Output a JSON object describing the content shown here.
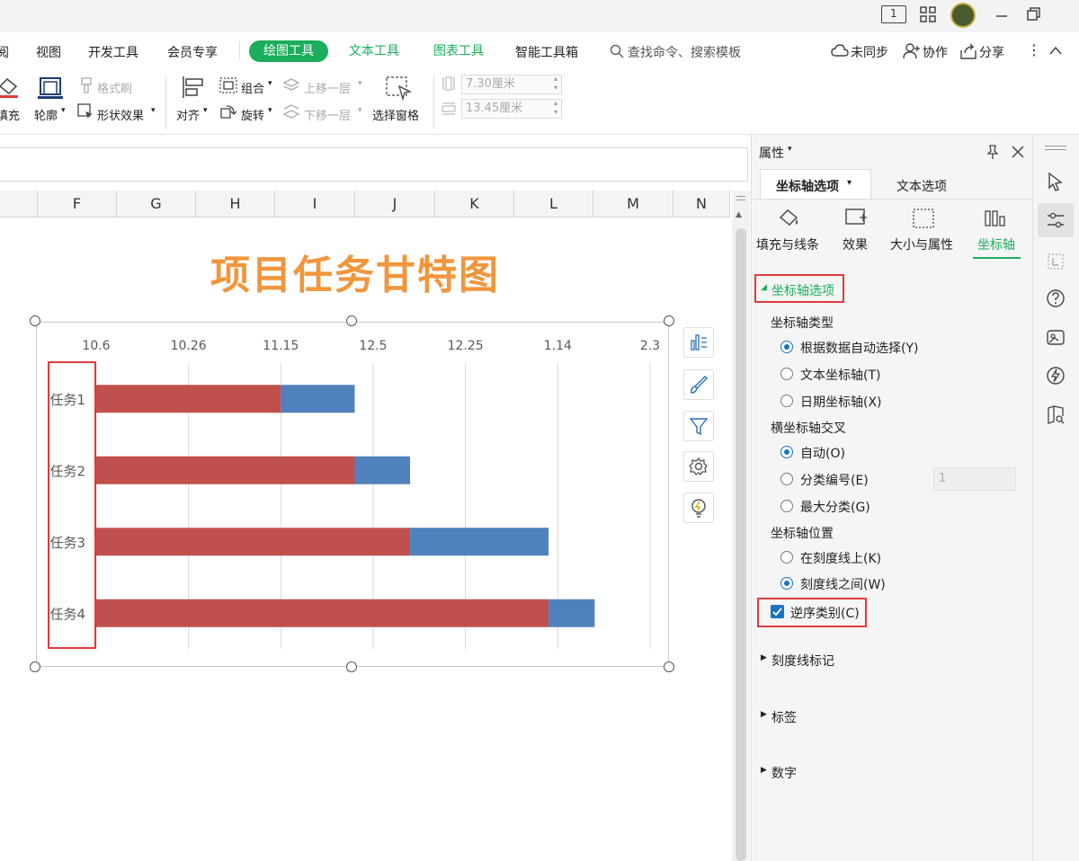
{
  "titlebar": {
    "page_indicator": "1"
  },
  "menu": {
    "items": [
      "阅",
      "视图",
      "开发工具",
      "会员专享"
    ],
    "drawing_tools": "绘图工具",
    "text_tools": "文本工具",
    "chart_tools": "图表工具",
    "smart_toolbox": "智能工具箱",
    "search_placeholder": "查找命令、搜索模板",
    "sync": "未同步",
    "collaborate": "协作",
    "share": "分享"
  },
  "ribbon": {
    "fill": "填充",
    "outline": "轮廓",
    "format_painter": "格式刷",
    "shape_effects": "形状效果",
    "align": "对齐",
    "group": "组合",
    "rotate": "旋转",
    "bring_forward": "上移一层",
    "send_backward": "下移一层",
    "selection_pane": "选择窗格",
    "height": "7.30厘米",
    "width": "13.45厘米"
  },
  "sheet": {
    "columns": [
      "F",
      "G",
      "H",
      "I",
      "J",
      "K",
      "L",
      "M",
      "N"
    ]
  },
  "chart_data": {
    "type": "bar",
    "title": "项目任务甘特图",
    "categories": [
      "任务1",
      "任务2",
      "任务3",
      "任务4"
    ],
    "x_tick_labels": [
      "10.6",
      "10.26",
      "11.15",
      "12.5",
      "12.25",
      "1.14",
      "2.3"
    ],
    "series": [
      {
        "values": [
          10.0,
          14.0,
          17.0,
          24.5
        ],
        "color": "#c0504d"
      },
      {
        "values": [
          4.0,
          3.0,
          7.5,
          2.5
        ],
        "color": "#4f81bd"
      }
    ],
    "xlim": [
      0,
      30
    ],
    "stacked": true,
    "grid": true,
    "category_order": "reversed"
  },
  "chart_tools": [
    "chart-elements",
    "chart-style",
    "chart-filter",
    "chart-settings",
    "chart-ideas"
  ],
  "panel": {
    "header": "属性",
    "tabs": {
      "axis_options": "坐标轴选项",
      "text_options": "文本选项"
    },
    "subtabs": [
      "填充与线条",
      "效果",
      "大小与属性",
      "坐标轴"
    ],
    "section_axis_options": "坐标轴选项",
    "axis_type": {
      "label": "坐标轴类型",
      "options": [
        "根据数据自动选择(Y)",
        "文本坐标轴(T)",
        "日期坐标轴(X)"
      ],
      "selected": 0
    },
    "cross": {
      "label": "横坐标轴交叉",
      "options": [
        "自动(O)",
        "分类编号(E)",
        "最大分类(G)"
      ],
      "selected": 0,
      "category_number": "1"
    },
    "position": {
      "label": "坐标轴位置",
      "options": [
        "在刻度线上(K)",
        "刻度线之间(W)"
      ],
      "selected": 1
    },
    "reverse_order": {
      "label": "逆序类别(C)",
      "checked": true
    },
    "sections": [
      "刻度线标记",
      "标签",
      "数字"
    ]
  },
  "colors": {
    "accent_green": "#1aad5b",
    "bar_red": "#c0504d",
    "bar_blue": "#4f81bd",
    "title_orange": "#f0963c",
    "highlight_red": "#e03a3a",
    "select_blue": "#1a73c8"
  }
}
